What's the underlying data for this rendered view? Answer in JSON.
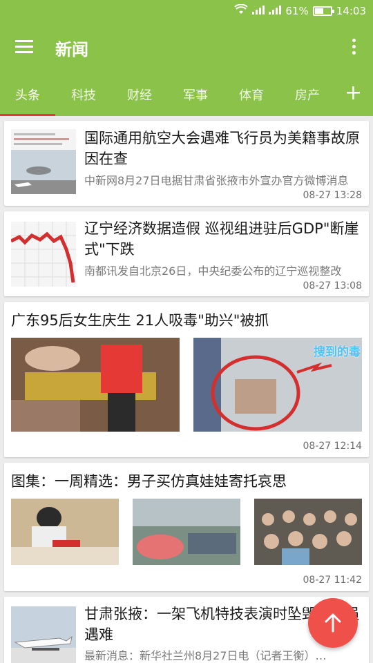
{
  "status_bar": {
    "battery_text": "61%",
    "time": "14:03",
    "battery_level": 0.61
  },
  "toolbar": {
    "title": "新闻"
  },
  "tabs": [
    {
      "label": "头条"
    },
    {
      "label": "科技"
    },
    {
      "label": "财经"
    },
    {
      "label": "军事"
    },
    {
      "label": "体育"
    },
    {
      "label": "房产"
    }
  ],
  "articles": [
    {
      "title": "国际通用航空大会遇难飞行员为美籍事故原因在查",
      "summary": "中新网8月27日电据甘肃省张掖市外宣办官方微博消息",
      "time": "08-27 13:28"
    },
    {
      "title": "辽宁经济数据造假 巡视组进驻后GDP\"断崖式\"下跌",
      "summary": "南都讯发自北京26日，中央纪委公布的辽宁巡视整改",
      "time": "08-27 13:08"
    },
    {
      "title": "广东95后女生庆生 21人吸毒\"助兴\"被抓",
      "image_caption": "搜到的毒",
      "time": "08-27 12:14"
    },
    {
      "title": "图集：一周精选：男子买仿真娃娃寄托哀思",
      "time": "08-27 11:42"
    },
    {
      "title": "甘肃张掖：一架飞机特技表演时坠毁飞行员遇难",
      "summary": "最新消息：新华社兰州8月27日电（记者王衡）…"
    }
  ],
  "colors": {
    "primary": "#8bc34a",
    "indicator": "#e53935",
    "fab": "#f0504a"
  }
}
